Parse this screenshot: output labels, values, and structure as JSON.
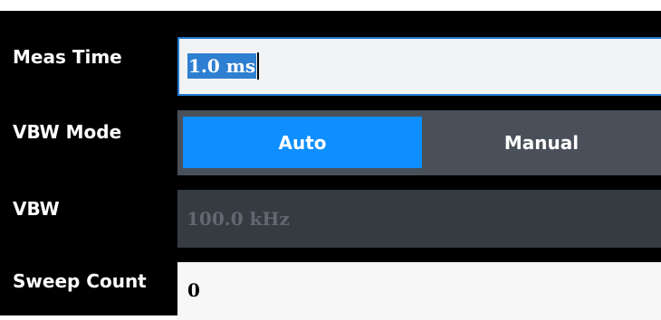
{
  "settings": {
    "meas_time": {
      "label": "Meas Time",
      "value": "1.0 ms"
    },
    "vbw_mode": {
      "label": "VBW Mode",
      "options": [
        "Auto",
        "Manual"
      ],
      "selected": "Auto"
    },
    "vbw": {
      "label": "VBW",
      "value": "100.0 kHz",
      "enabled": false
    },
    "sweep_count": {
      "label": "Sweep Count",
      "value": "0"
    }
  },
  "colors": {
    "panel_background": "#000000",
    "label_text": "#ffffff",
    "input_background": "#f2f3f5",
    "focus_border": "#1e7ad1",
    "selection_highlight": "#2e7fd1",
    "toggle_selected": "#0d8fff",
    "toggle_background": "#4a5059",
    "disabled_field_background": "#353b41",
    "disabled_text": "#626870"
  }
}
